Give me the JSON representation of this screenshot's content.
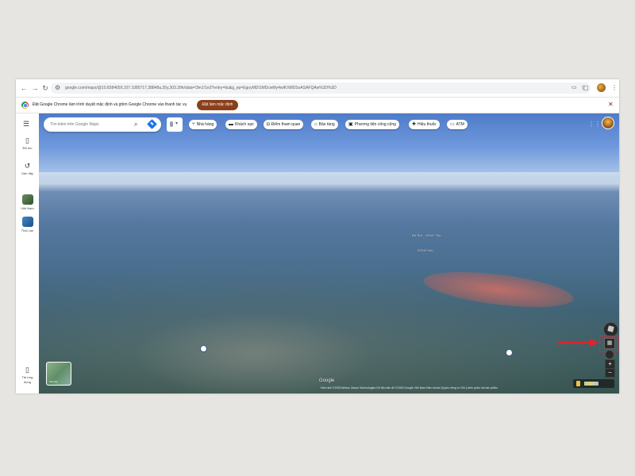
{
  "browser": {
    "url": "google.com/maps/@10.8384659,107.1085717,38848a,35y,303.39h/data=!3m1!1e3?entry=ttu&g_ep=EgoyMDI1MDcwMy4wIKXMDSoASAFQAw%3D%3D",
    "infobar_text": "Đặt Google Chrome làm trình duyệt mặc định và ghim Google Chrome vào thanh tác vụ",
    "default_button": "Đặt làm mặc định"
  },
  "sidebar": {
    "items": [
      {
        "label": "Đã lưu",
        "icon": "bookmark-icon"
      },
      {
        "label": "Gần đây",
        "icon": "history-icon"
      },
      {
        "label": "Việt Nam",
        "icon": "place-thumbnail"
      },
      {
        "label": "Thái Lan",
        "icon": "place-thumbnail"
      }
    ],
    "download_label_1": "Tải ứng",
    "download_label_2": "dụng"
  },
  "search": {
    "placeholder": "Tìm kiếm trên Google Maps"
  },
  "chips": [
    {
      "label": "Nhà hàng",
      "icon": "fork-knife-icon"
    },
    {
      "label": "Khách sạn",
      "icon": "bed-icon"
    },
    {
      "label": "Điểm tham quan",
      "icon": "camera-icon"
    },
    {
      "label": "Bảo tàng",
      "icon": "museum-icon"
    },
    {
      "label": "Phương tiện công cộng",
      "icon": "transit-icon"
    },
    {
      "label": "Hiệu thuốc",
      "icon": "pharmacy-icon"
    },
    {
      "label": "ATM",
      "icon": "atm-icon"
    }
  ],
  "map_labels": {
    "ba_ria_vung_tau": "BÀ RỊA - VŨNG TÀU",
    "dong_nai": "ĐỒNG NAI"
  },
  "map": {
    "google_logo": "Google",
    "footer": "Hình ảnh ©2025 Airbus, Maxar Technologies  Dữ liệu bản đồ ©2025  Google  Việt Nam  Điều khoản  Quyền riêng tư  Gửi ý kiến phản hồi sản phẩm",
    "layers_thumb_label": "Các lớp"
  },
  "colors": {
    "accent_button": "#8a3f1b",
    "highlight_red": "#e0232e"
  }
}
